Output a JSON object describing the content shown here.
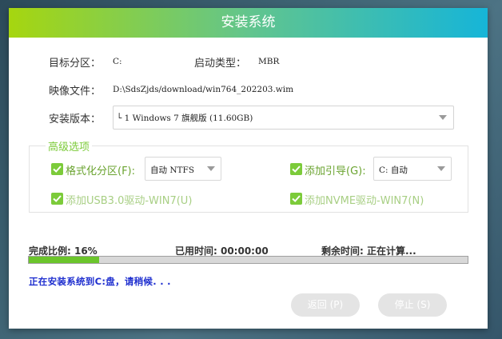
{
  "window": {
    "title": "安装系统"
  },
  "fields": {
    "target_partition_label": "目标分区：",
    "target_partition_value": "C:",
    "boot_type_label": "启动类型：",
    "boot_type_value": "MBR",
    "image_file_label": "映像文件：",
    "image_file_value": "D:\\SdsZjds/download/win764_202203.wim",
    "version_label": "安装版本：",
    "version_value": "└ 1 Windows 7 旗舰版 (11.60GB)"
  },
  "advanced": {
    "title": "高级选项",
    "format_partition": {
      "label": "格式化分区(F):",
      "checked": true,
      "select_value": "自动 NTFS"
    },
    "add_boot": {
      "label": "添加引导(G):",
      "checked": true,
      "select_value": "C: 自动"
    },
    "usb3": {
      "label": "添加USB3.0驱动-WIN7(U)",
      "checked": true
    },
    "nvme": {
      "label": "添加NVME驱动-WIN7(N)",
      "checked": true
    }
  },
  "progress": {
    "ratio_text": "完成比例: 16%",
    "elapsed_text": "已用时间: 00:00:00",
    "remaining_text": "剩余时间: 正在计算...",
    "fraction": 0.16,
    "status_text": "正在安装系统到C:盘，请稍候. . ."
  },
  "buttons": {
    "back": "返回 (P)",
    "stop": "停止 (S)"
  },
  "colors": {
    "accent_green": "#7ccb3a",
    "status_blue": "#1f2fcf",
    "progress_fill": "#6bc52b"
  }
}
